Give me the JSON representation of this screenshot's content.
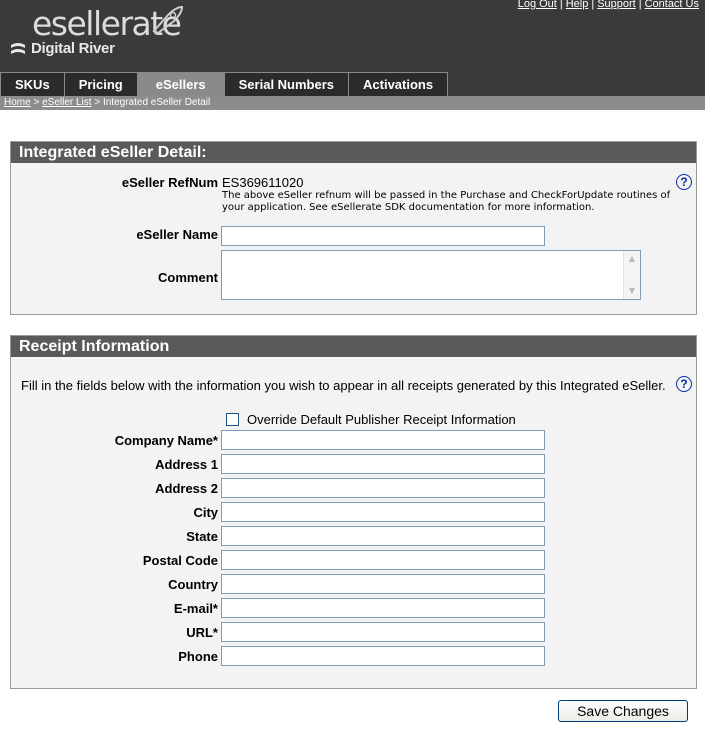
{
  "brand": {
    "logo_text": "esellerate",
    "company": "Digital River"
  },
  "top_links": [
    "Log Out",
    "Help",
    "Support",
    "Contact Us"
  ],
  "tabs": [
    {
      "label": "SKUs",
      "active": false
    },
    {
      "label": "Pricing",
      "active": false
    },
    {
      "label": "eSellers",
      "active": true
    },
    {
      "label": "Serial Numbers",
      "active": false
    },
    {
      "label": "Activations",
      "active": false
    }
  ],
  "breadcrumb": {
    "home": "Home",
    "sep1": " > ",
    "list": "eSeller List",
    "sep2": " > ",
    "current": "Integrated eSeller Detail"
  },
  "detail": {
    "title": "Integrated eSeller Detail:",
    "refnum_label": "eSeller RefNum",
    "refnum_value": "ES369611020",
    "refnum_note": "The above eSeller refnum will be passed in the Purchase and CheckForUpdate routines of your application. See eSellerate SDK documentation for more information.",
    "name_label": "eSeller Name",
    "name_value": "",
    "comment_label": "Comment",
    "comment_value": "",
    "help": "?"
  },
  "receipt": {
    "title": "Receipt Information",
    "intro": "Fill in the fields below with the information you wish to appear in all receipts generated by this Integrated eSeller.",
    "override_label": "Override Default Publisher Receipt Information",
    "override_checked": false,
    "help": "?",
    "fields": [
      {
        "label": "Company Name*",
        "value": ""
      },
      {
        "label": "Address 1",
        "value": ""
      },
      {
        "label": "Address 2",
        "value": ""
      },
      {
        "label": "City",
        "value": ""
      },
      {
        "label": "State",
        "value": ""
      },
      {
        "label": "Postal Code",
        "value": ""
      },
      {
        "label": "Country",
        "value": ""
      },
      {
        "label": "E-mail*",
        "value": ""
      },
      {
        "label": "URL*",
        "value": ""
      },
      {
        "label": "Phone",
        "value": ""
      }
    ]
  },
  "save_button": "Save Changes",
  "colors": {
    "header_bg": "#3a3a3a",
    "tab_active": "#8a8a8a",
    "panel_title_bg": "#5a5a5a",
    "panel_bg": "#f3f3f3",
    "help_blue": "#0a2ca4"
  }
}
